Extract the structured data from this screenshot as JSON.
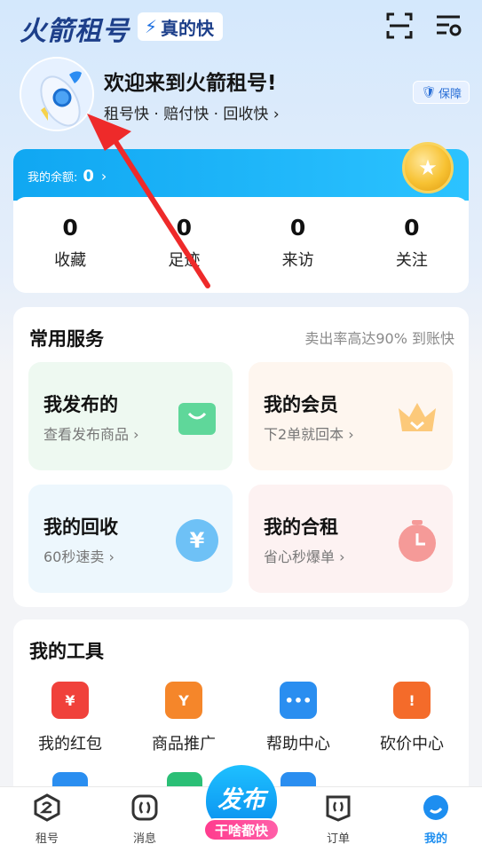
{
  "header": {
    "brand": "火箭租号",
    "badge": "真的快"
  },
  "profile": {
    "welcome": "欢迎来到火箭租号!",
    "subtitle": "租号快 · 赔付快 · 回收快",
    "guarantee": "保障"
  },
  "balance": {
    "label": "我的余额:",
    "amount": "0"
  },
  "stats": [
    {
      "value": "0",
      "label": "收藏"
    },
    {
      "value": "0",
      "label": "足迹"
    },
    {
      "value": "0",
      "label": "来访"
    },
    {
      "value": "0",
      "label": "关注"
    }
  ],
  "services": {
    "title": "常用服务",
    "subtitle": "卖出率高达90% 到账快",
    "items": [
      {
        "title": "我发布的",
        "desc": "查看发布商品",
        "icon": "bag-icon",
        "bg": "#eef9f1"
      },
      {
        "title": "我的会员",
        "desc": "下2单就回本",
        "icon": "crown-icon",
        "bg": "#fef6ef"
      },
      {
        "title": "我的回收",
        "desc": "60秒速卖",
        "icon": "yen-coin-icon",
        "bg": "#edf7fd"
      },
      {
        "title": "我的合租",
        "desc": "省心秒爆单",
        "icon": "stopwatch-icon",
        "bg": "#fdf2f2"
      }
    ]
  },
  "tools": {
    "title": "我的工具",
    "items": [
      {
        "label": "我的红包",
        "icon": "red-packet-icon",
        "color": "#f0413b"
      },
      {
        "label": "商品推广",
        "icon": "promotion-icon",
        "color": "#f5862a"
      },
      {
        "label": "帮助中心",
        "icon": "chat-help-icon",
        "color": "#2a8ef0"
      },
      {
        "label": "砍价中心",
        "icon": "bargain-icon",
        "color": "#f46b2a"
      }
    ]
  },
  "tabbar": {
    "items": [
      {
        "label": "租号",
        "icon": "rent-icon"
      },
      {
        "label": "消息",
        "icon": "message-icon"
      },
      {
        "label": "订单",
        "icon": "order-icon"
      },
      {
        "label": "我的",
        "icon": "mine-icon"
      }
    ],
    "publish_label": "发布",
    "publish_tag": "干啥都快"
  },
  "colors": {
    "brand": "#1d3f8a",
    "accent": "#1d8ef0",
    "balance_bar": "#10a7f2",
    "annotation_arrow": "#ee2a2a"
  }
}
